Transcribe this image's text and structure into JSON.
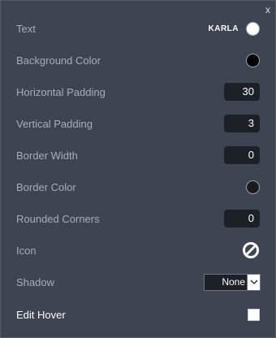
{
  "close_label": "x",
  "rows": {
    "text": {
      "label": "Text",
      "font": "KARLA",
      "swatch_color": "#ffffff"
    },
    "background_color": {
      "label": "Background Color",
      "swatch_color": "#000000"
    },
    "horizontal_padding": {
      "label": "Horizontal Padding",
      "value": "30"
    },
    "vertical_padding": {
      "label": "Vertical Padding",
      "value": "3"
    },
    "border_width": {
      "label": "Border Width",
      "value": "0"
    },
    "border_color": {
      "label": "Border Color",
      "swatch_color": "#1b1b1b"
    },
    "rounded_corners": {
      "label": "Rounded Corners",
      "value": "0"
    },
    "icon": {
      "label": "Icon",
      "icon_name": "no-icon"
    },
    "shadow": {
      "label": "Shadow",
      "value": "None"
    },
    "edit_hover": {
      "label": "Edit Hover",
      "checked": false
    }
  }
}
